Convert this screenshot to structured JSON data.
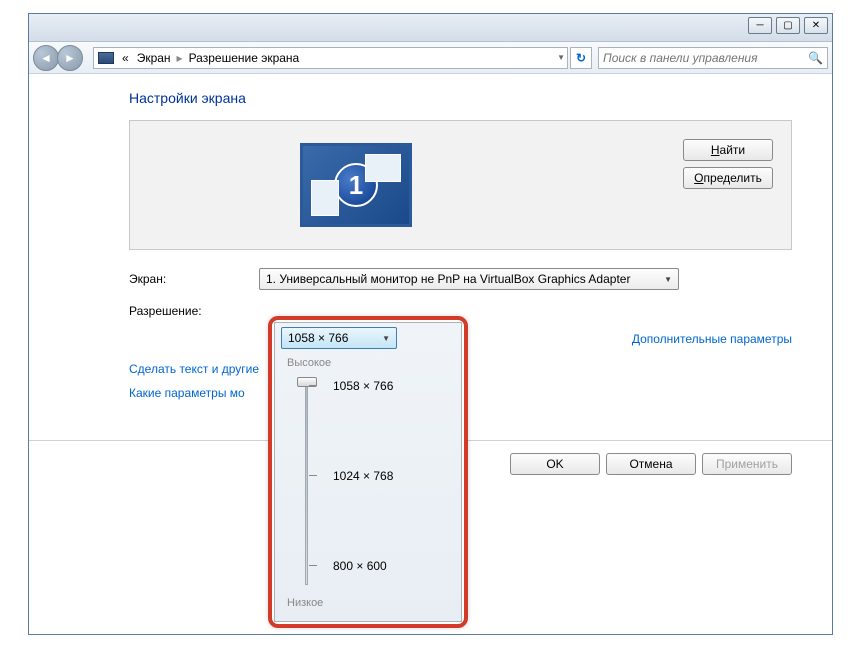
{
  "breadcrumb": {
    "part1": "Экран",
    "part2": "Разрешение экрана",
    "chevrons": "«"
  },
  "search": {
    "placeholder": "Поиск в панели управления"
  },
  "page": {
    "title": "Настройки экрана"
  },
  "monitor": {
    "number": "1"
  },
  "buttons": {
    "find": "Найти",
    "detect": "Определить",
    "ok": "OK",
    "cancel": "Отмена",
    "apply": "Применить"
  },
  "labels": {
    "screen": "Экран:",
    "resolution": "Разрешение:"
  },
  "screen_dropdown": {
    "selected": "1. Универсальный монитор не PnP на VirtualBox Graphics Adapter"
  },
  "resolution_dropdown": {
    "selected": "1058 × 766"
  },
  "links": {
    "advanced": "Дополнительные параметры",
    "text_size": "Сделать текст и другие",
    "which_params": "Какие параметры мо"
  },
  "slider": {
    "high": "Высокое",
    "low": "Низкое",
    "options": [
      {
        "label": "1058 × 766",
        "pos": 24
      },
      {
        "label": "1024 × 768",
        "pos": 114
      },
      {
        "label": "800 × 600",
        "pos": 204
      }
    ]
  }
}
